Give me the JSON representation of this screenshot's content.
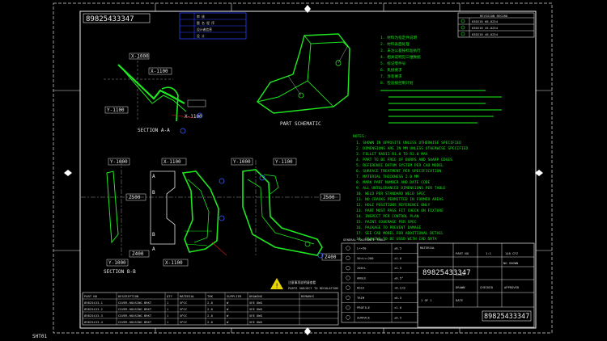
{
  "sheet": {
    "drawing_number": "89825433347",
    "drawing_number_bottom": "89825433347",
    "corner_tag": "SHT01"
  },
  "header_table": {
    "rows": [
      "审 核",
      "题 名 程 序",
      "设计者信息",
      "设 计"
    ]
  },
  "revision_table": {
    "title": "REVISION RECORD",
    "rows": [
      "03D218 08-0254",
      "03D218 45-0254",
      "03D218 48-0254"
    ]
  },
  "views": {
    "section_aa_label": "SECTION A-A",
    "section_aa_dims": [
      "X-1000",
      "X-1100",
      "Y-1100",
      "X-1100"
    ],
    "part_schematic_label": "PART SCHEMATIC",
    "main_view_dims": [
      "Y-1000",
      "X-1100",
      "Y-1000",
      "Y-1100",
      "Z500",
      "Z500",
      "Z400",
      "Z400",
      "Y-1000",
      "X-1100"
    ],
    "section_bb_label": "SECTION B-B",
    "zone_labels": [
      "A",
      "B",
      "B",
      "A"
    ]
  },
  "notes": {
    "heading": "NOTES:",
    "lines": [
      "1. SHOWN IN OPPOSITE UNLESS OTHERWISE SPECIFIED",
      "2. DIMENSIONS ARE IN MM UNLESS OTHERWISE SPECIFIED",
      "3. FILLET RADII R1.0 TO R2.0 MAX",
      "4. PART TO BE FREE OF BURRS AND SHARP EDGES",
      "5. REFERENCE DATUM SYSTEM PER CAD MODEL",
      "6. SURFACE TREATMENT PER SPECIFICATION",
      "7. MATERIAL THICKNESS 2.0 MM",
      "8. MARK PART NUMBER AND DATE CODE",
      "9. ALL UNTOLERANCED DIMENSIONS PER TABLE",
      "10. WELD PER STANDARD WELD SPEC",
      "11. NO CRACKS PERMITTED IN FORMED AREAS",
      "12. HOLE POSITIONS REFERENCE ONLY",
      "13. PART MUST PASS FIT CHECK ON FIXTURE",
      "14. INSPECT PER CONTROL PLAN",
      "15. PAINT COVERAGE PER SPEC",
      "16. PACKAGE TO PREVENT DAMAGE",
      "17. SEE CAD MODEL FOR ADDITIONAL DETAIL",
      "18. DRAWING TO BE USED WITH CAD DATA"
    ],
    "top_notes": [
      "1. 材料为指定件说明",
      "2. 材料表面处理",
      "3. 未注公差按标准执行",
      "4. 相关说明见三维数据",
      "5. 标记零件号",
      "6. 焦接要求",
      "7. 涂装要求",
      "8. 检验按控制计划"
    ]
  },
  "tolerance_table": {
    "title": "GENERAL TOLERANCE TABLE",
    "rows": [
      [
        "L<=50",
        "±0.5"
      ],
      [
        "50<L<=200",
        "±1.0"
      ],
      [
        "200<L",
        "±1.5"
      ],
      [
        "ANGLE",
        "±0.5°"
      ],
      [
        "HOLE",
        "+0.2/0"
      ],
      [
        "TRIM",
        "±0.5"
      ],
      [
        "PROFILE",
        "±1.0"
      ],
      [
        "SURFACE",
        "±0.5"
      ]
    ]
  },
  "title_block": {
    "material_title": "MATERIAL",
    "cells": [
      "PART NO",
      "1:1",
      "140 CFZ",
      "NO SHOWN",
      "SCALE",
      "DRAWN",
      "CHECKED",
      "APPROVED",
      "DATE"
    ],
    "part_number": "89825433347",
    "sheet_info": "1 OF 1"
  },
  "warning": {
    "text": "注意事项说明请查看",
    "subtext": "PARTS SUBJECT TO REGULATION"
  },
  "bom": {
    "headers": [
      "PART NO",
      "DESCRIPTION",
      "QTY",
      "MATERIAL",
      "THK",
      "SUPPLIER",
      "DRAWING",
      "REMARKS"
    ],
    "rows": [
      [
        "89825433-1",
        "COVER-HOUSING BRKT",
        "1",
        "SPCC",
        "2.0",
        "W",
        "SEE DWG",
        ""
      ],
      [
        "89825433-2",
        "COVER-HOUSING BRKT",
        "1",
        "SPCC",
        "2.0",
        "W",
        "SEE DWG",
        ""
      ],
      [
        "89825433-3",
        "COVER-HOUSING BRKT",
        "1",
        "SPCC",
        "2.0",
        "W",
        "SEE DWG",
        ""
      ],
      [
        "89825433-4",
        "COVER-HOUSING BRKT",
        "1",
        "SPCC",
        "2.0",
        "W",
        "SEE DWG",
        ""
      ]
    ]
  },
  "colors": {
    "background": "#000000",
    "line_white": "#f0f0f0",
    "part_green": "#1fe81f",
    "accent_blue": "#2040ff",
    "accent_yellow": "#e8d400",
    "accent_red": "#e02020"
  }
}
